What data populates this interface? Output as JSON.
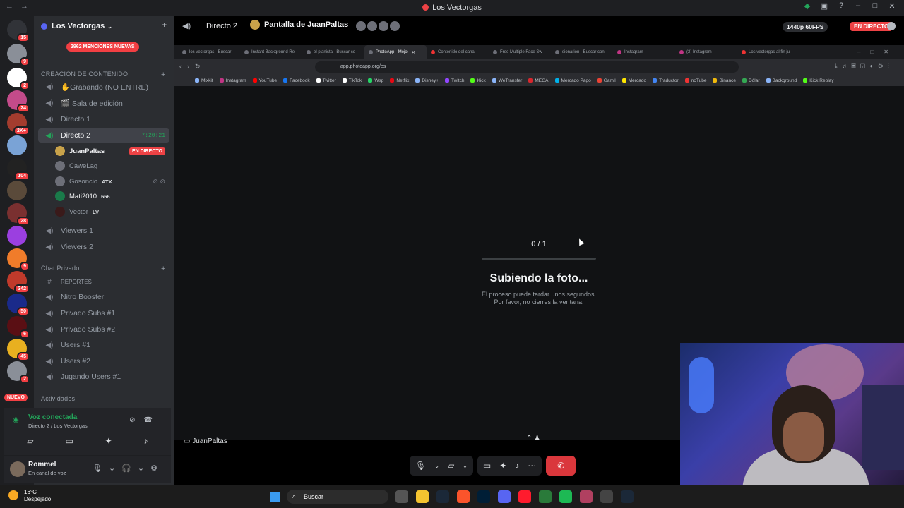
{
  "titlebar": {
    "title": "Los Vectorgas"
  },
  "rail": {
    "badges": [
      "15",
      "9",
      "2",
      "24",
      "2K+",
      "104",
      "28",
      "9",
      "342",
      "50",
      "6",
      "45",
      "2"
    ],
    "nuevo": "NUEVO"
  },
  "sidebar": {
    "server_name": "Los Vectorgas",
    "mentions": "2962 MENCIONES NUEVAS",
    "cat_content": "CREACIÓN DE CONTENIDO",
    "channels_content": [
      {
        "label": "✋Grabando (NO ENTRE)"
      },
      {
        "label": "🎬 Sala de edición"
      },
      {
        "label": "Directo 1"
      },
      {
        "label": "Directo 2"
      }
    ],
    "timer": "7:20:21",
    "users": [
      {
        "name": "JuanPaltas",
        "tag": "",
        "live": "EN DIRECTO"
      },
      {
        "name": "CaweLag",
        "tag": ""
      },
      {
        "name": "Gosoncio",
        "tag": "ATX"
      },
      {
        "name": "Mati2010",
        "tag": "666"
      },
      {
        "name": "Vector",
        "tag": "LV"
      }
    ],
    "channels_viewers": [
      {
        "label": "Viewers 1"
      },
      {
        "label": "Viewers 2"
      }
    ],
    "cat_private": "Chat Privado",
    "channels_private": [
      {
        "label": "REPORTES"
      },
      {
        "label": "Nitro Booster"
      },
      {
        "label": "Privado Subs #1"
      },
      {
        "label": "Privado Subs #2"
      },
      {
        "label": "Users #1"
      },
      {
        "label": "Users #2"
      },
      {
        "label": "Jugando Users #1"
      }
    ],
    "cat_activities": "Actividades"
  },
  "voice": {
    "status": "Voz conectada",
    "channel": "Directo 2 / Los Vectorgas"
  },
  "user": {
    "name": "Rommel",
    "status": "En canal de voz"
  },
  "stage": {
    "channel": "Directo 2",
    "screen_title": "Pantalla de JuanPaltas",
    "quality": "1440p 60FPS",
    "live": "EN DIRECTO",
    "streamer_label": "JuanPaltas"
  },
  "browser": {
    "tabs": [
      "los vectorgas - Buscar",
      "Instant Background Re",
      "el pianista - Buscar co",
      "PhotoApp - Mejo",
      "Contenido del canal",
      "Free Multiple Face Sw",
      "sionarion - Buscar con",
      "Instagram",
      "(2) Instagram",
      "Los vectorgas al fin ju"
    ],
    "url": "app.photoapp.org/es",
    "bookmarks": [
      "Mixkit",
      "Instagram",
      "YouTube",
      "Facebook",
      "Twitter",
      "TikTok",
      "Wsp",
      "Netflix",
      "Disney+",
      "Twitch",
      "Kick",
      "WeTransfer",
      "MEGA",
      "Mercado Pago",
      "Gamil",
      "Mercado",
      "Traductor",
      "noTube",
      "Binance",
      "Dólar",
      "Background",
      "Kick Replay"
    ],
    "page": {
      "counter": "0 / 1",
      "progress": 0,
      "title": "Subiendo la foto...",
      "desc1": "El proceso puede tardar unos segundos.",
      "desc2": "Por favor, no cierres la ventana."
    }
  },
  "taskbar": {
    "temp": "16°C",
    "weather": "Despejado",
    "search": "Buscar"
  }
}
